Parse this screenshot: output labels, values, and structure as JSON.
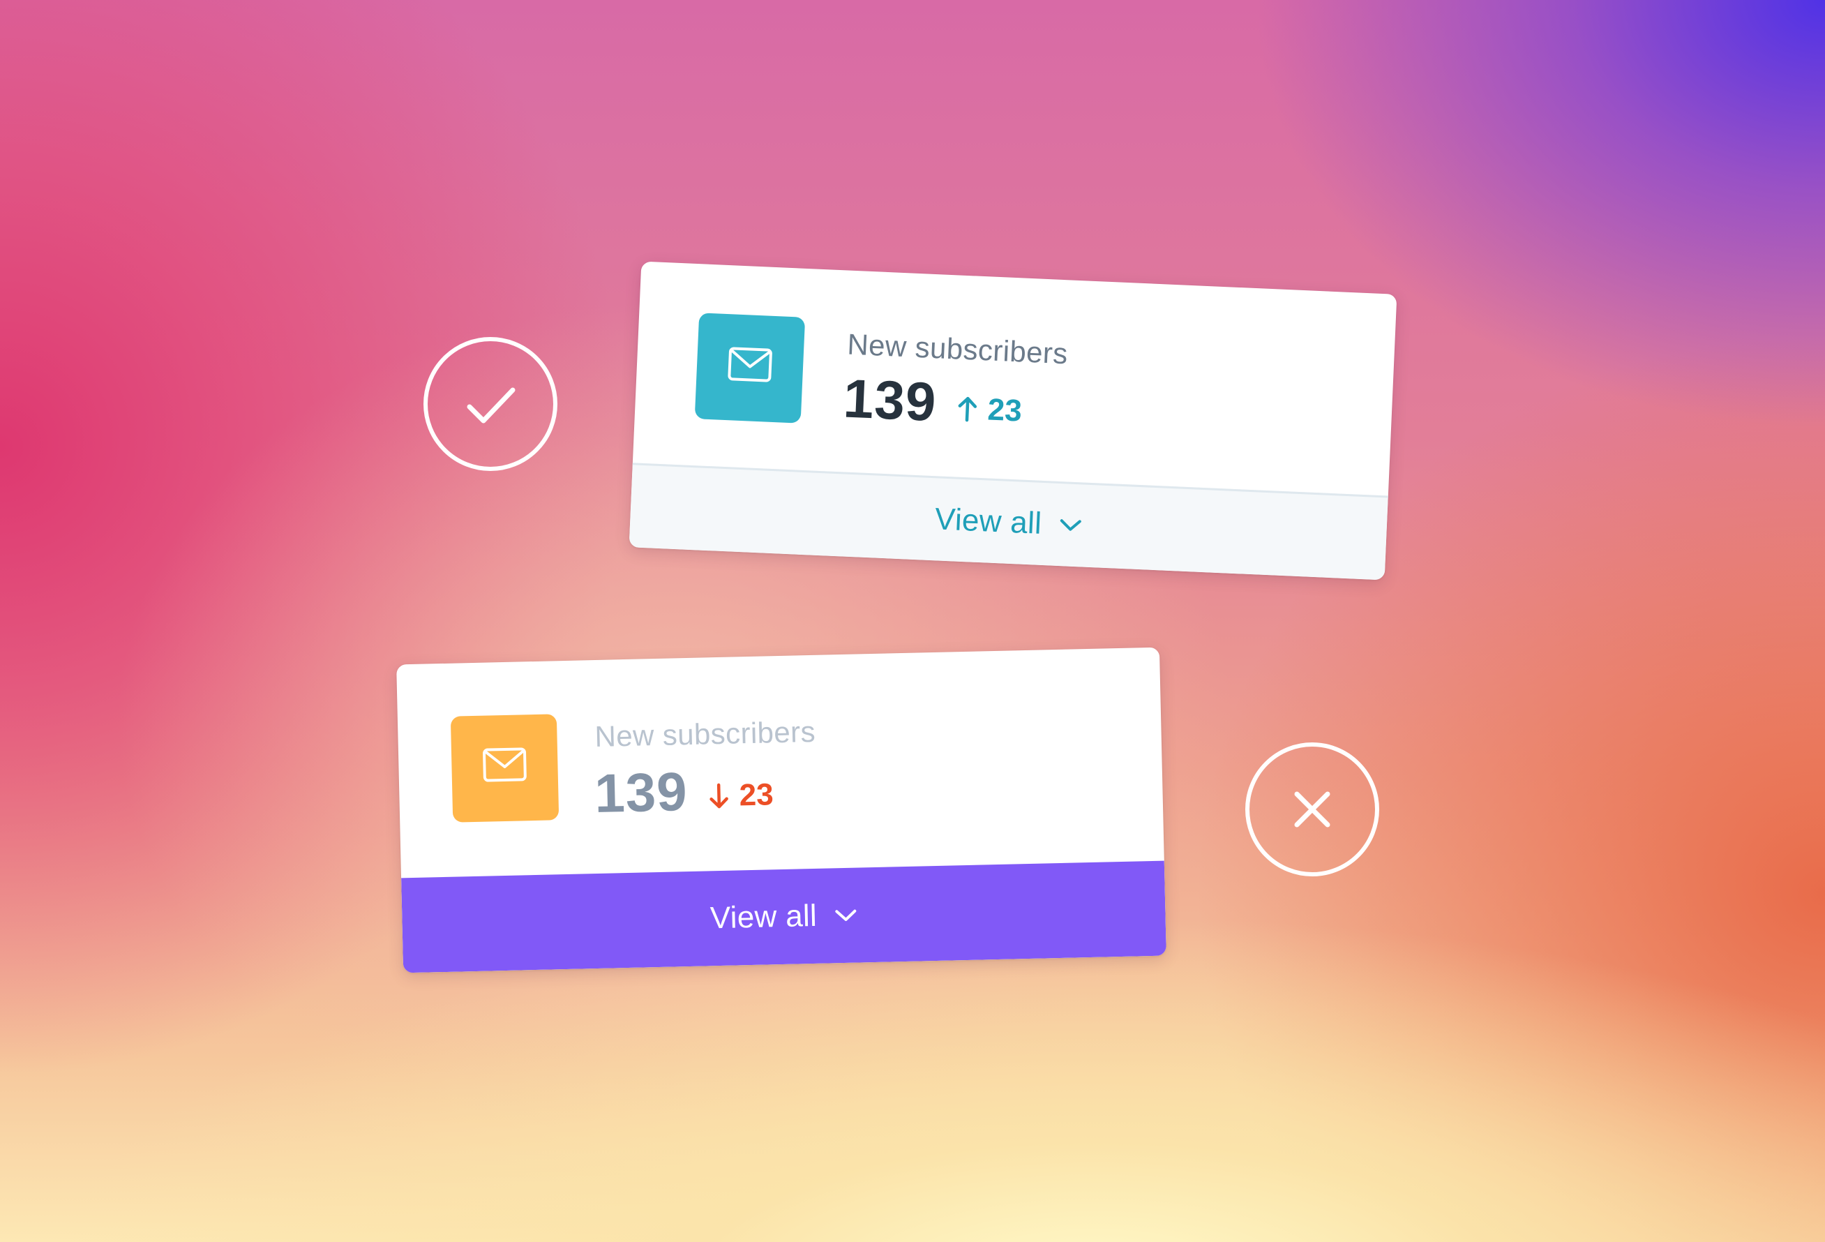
{
  "colors": {
    "good_icon_bg": "#35b6cc",
    "good_label": "#6b7a8a",
    "good_value": "#27323d",
    "good_delta": "#1f9fb8",
    "bad_icon_bg": "#ffb64a",
    "bad_label": "#b9c3cf",
    "bad_value": "#8493a6",
    "bad_delta": "#ec4f26",
    "bad_footer_bg": "#8159f7"
  },
  "good_example": {
    "verdict_icon": "check-circle-icon",
    "card": {
      "icon": "envelope-icon",
      "label": "New subscribers",
      "value": "139",
      "delta_icon": "arrow-up-icon",
      "delta": "23",
      "footer_label": "View all",
      "footer_icon": "chevron-down-icon"
    }
  },
  "bad_example": {
    "verdict_icon": "x-circle-icon",
    "card": {
      "icon": "envelope-icon",
      "label": "New subscribers",
      "value": "139",
      "delta_icon": "arrow-down-icon",
      "delta": "23",
      "footer_label": "View all",
      "footer_icon": "chevron-down-icon"
    }
  }
}
